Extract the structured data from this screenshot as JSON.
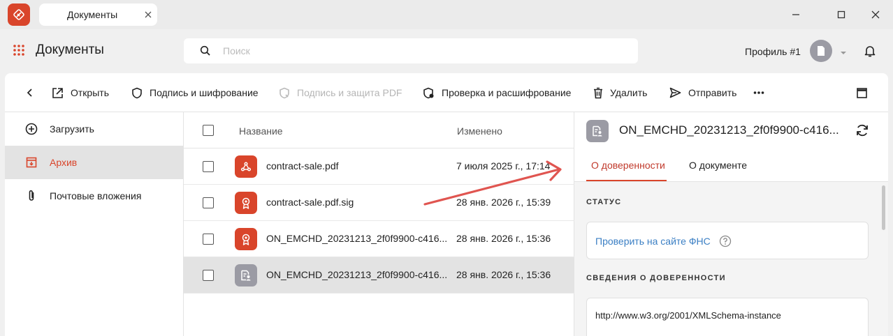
{
  "tab": {
    "title": "Документы"
  },
  "header": {
    "title": "Документы",
    "search_placeholder": "Поиск",
    "profile_name": "Профиль #1"
  },
  "toolbar": {
    "open": "Открыть",
    "sign_encrypt": "Подпись и шифрование",
    "sign_protect_pdf": "Подпись и защита PDF",
    "verify_decrypt": "Проверка и расшифрование",
    "delete": "Удалить",
    "send": "Отправить"
  },
  "sidebar": {
    "items": [
      {
        "label": "Загрузить",
        "icon": "plus-circle-icon"
      },
      {
        "label": "Архив",
        "icon": "archive-icon",
        "active": true
      },
      {
        "label": "Почтовые вложения",
        "icon": "paperclip-icon"
      }
    ]
  },
  "list": {
    "columns": {
      "name": "Название",
      "modified": "Изменено"
    },
    "rows": [
      {
        "name": "contract-sale.pdf",
        "modified": "7 июля 2025 г., 17:14",
        "icon": "pdf-icon"
      },
      {
        "name": "contract-sale.pdf.sig",
        "modified": "28 янв. 2026 г., 15:39",
        "icon": "certificate-icon"
      },
      {
        "name": "ON_EMCHD_20231213_2f0f9900-c416...",
        "modified": "28 янв. 2026 г., 15:36",
        "icon": "certificate-icon"
      },
      {
        "name": "ON_EMCHD_20231213_2f0f9900-c416...",
        "modified": "28 янв. 2026 г., 15:36",
        "icon": "power-of-attorney-icon",
        "selected": true
      }
    ]
  },
  "details": {
    "title": "ON_EMCHD_20231213_2f0f9900-c416...",
    "tabs": [
      "О доверенности",
      "О документе"
    ],
    "status_title": "СТАТУС",
    "status_link": "Проверить на сайте ФНС",
    "info_title": "СВЕДЕНИЯ О ДОВЕРЕННОСТИ",
    "info_value": "http://www.w3.org/2001/XMLSchema-instance"
  },
  "colors": {
    "accent": "#d9452b",
    "selected_row": "#e3e3e3",
    "link": "#3b7fc4",
    "neutral_icon": "#9b9ba4"
  }
}
